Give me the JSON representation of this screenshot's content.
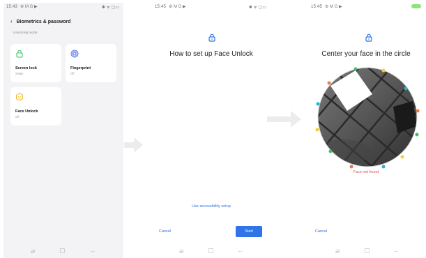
{
  "screen1": {
    "status": {
      "time": "15:43",
      "left_icons": "⚙ M G ▶",
      "right_icons": "✱ ᯤ ▢▭"
    },
    "header": {
      "title": "Biometrics & password"
    },
    "section_label": "Unlocking mode",
    "cards": [
      {
        "title": "Screen lock",
        "subtitle": "Swipe"
      },
      {
        "title": "Fingerprint",
        "subtitle": "Off"
      },
      {
        "title": "Face Unlock",
        "subtitle": "Off"
      }
    ]
  },
  "screen2": {
    "status": {
      "time": "15:45",
      "left_icons": "⚙ M G ▶",
      "right_icons": "✱ ᯤ ▢▭"
    },
    "heading": "How to set up Face Unlock",
    "accessibility_link": "Use accessibility setup",
    "cancel_label": "Cancel",
    "start_label": "Start"
  },
  "screen3": {
    "status": {
      "time": "15:45",
      "left_icons": "⚙ M G ▶"
    },
    "heading": "Center your face in the circle",
    "error_text": "Face not found",
    "cancel_label": "Cancel"
  },
  "colors": {
    "accent": "#2f74e8",
    "error": "#e05050",
    "card_icon": "#3bbf6a",
    "fingerprint_icon": "#4a63d8",
    "face_icon": "#f2b830"
  },
  "icons": [
    "back-chevron-icon",
    "lock-icon",
    "fingerprint-icon",
    "face-icon",
    "recent-apps-icon",
    "home-icon",
    "back-arrow-icon",
    "transition-arrow-icon"
  ]
}
